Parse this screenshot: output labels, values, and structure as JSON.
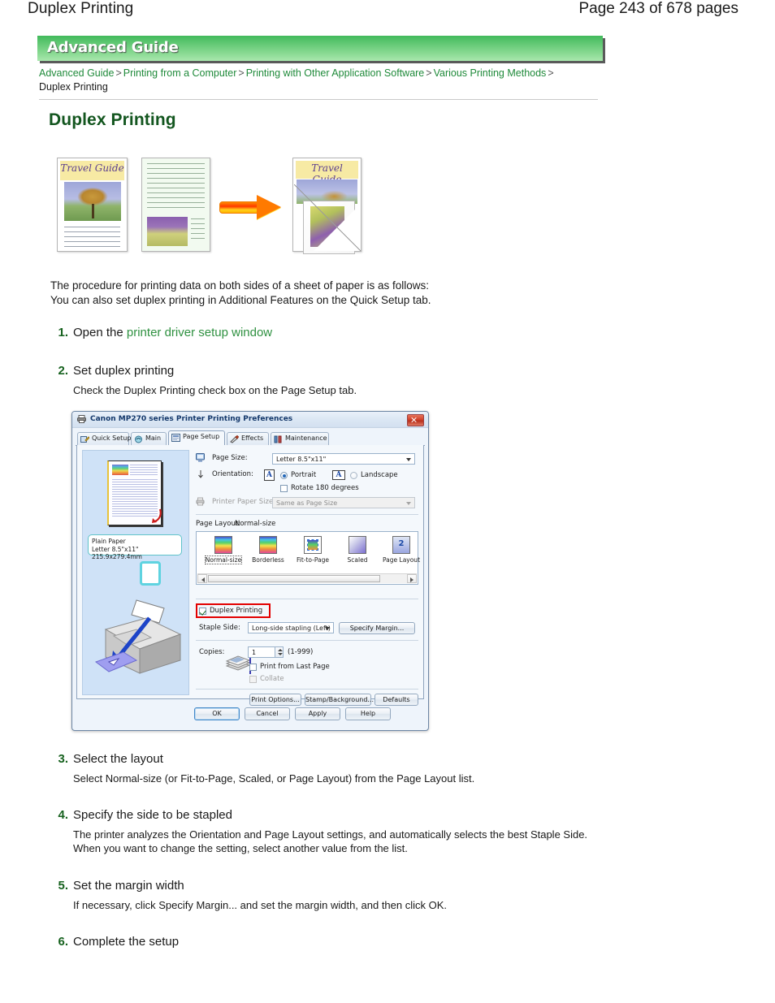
{
  "runhead": {
    "title": "Duplex Printing",
    "page_indicator": "Page 243 of 678 pages"
  },
  "guide": {
    "banner_label": "Advanced Guide",
    "breadcrumbs": [
      {
        "label": "Advanced Guide",
        "link": true
      },
      {
        "label": "Printing from a Computer",
        "link": true
      },
      {
        "label": "Printing with Other Application Software",
        "link": true
      },
      {
        "label": "Various Printing Methods",
        "link": true
      },
      {
        "label": "Duplex Printing",
        "link": false
      }
    ],
    "separator": ">"
  },
  "page": {
    "heading": "Duplex Printing",
    "intro_line1": "The procedure for printing data on both sides of a sheet of paper is as follows:",
    "intro_line2": "You can also set duplex printing in Additional Features on the Quick Setup tab."
  },
  "illustration": {
    "front_title": "Travel Guide",
    "result_title": "Travel Guide",
    "arrow": "right-arrow"
  },
  "steps": [
    {
      "num": "1.",
      "title_prefix": "Open the ",
      "title_link": "printer driver setup window",
      "body": ""
    },
    {
      "num": "2.",
      "title": "Set duplex printing",
      "body": "Check the Duplex Printing check box on the Page Setup tab."
    },
    {
      "num": "3.",
      "title": "Select the layout",
      "body": "Select Normal-size (or Fit-to-Page, Scaled, or Page Layout) from the Page Layout list."
    },
    {
      "num": "4.",
      "title": "Specify the side to be stapled",
      "body": "The printer analyzes the Orientation and Page Layout settings, and automatically selects the best Staple Side. When you want to change the setting, select another value from the list."
    },
    {
      "num": "5.",
      "title": "Set the margin width",
      "body": "If necessary, click Specify Margin... and set the margin width, and then click OK."
    },
    {
      "num": "6.",
      "title": "Complete the setup",
      "body": ""
    }
  ],
  "dialog": {
    "title": "Canon MP270 series Printer Printing Preferences",
    "close_label": "x",
    "tabs": [
      {
        "label": "Quick Setup",
        "icon": "quick-setup-icon",
        "selected": false
      },
      {
        "label": "Main",
        "icon": "main-icon",
        "selected": false
      },
      {
        "label": "Page Setup",
        "icon": "page-setup-icon",
        "selected": true
      },
      {
        "label": "Effects",
        "icon": "effects-icon",
        "selected": false
      },
      {
        "label": "Maintenance",
        "icon": "maintenance-icon",
        "selected": false
      }
    ],
    "preview": {
      "paper_type": "Plain Paper",
      "paper_size": "Letter 8.5\"x11\" 215.9x279.4mm"
    },
    "page_size": {
      "label": "Page Size:",
      "value": "Letter 8.5\"x11\""
    },
    "orientation": {
      "label": "Orientation:",
      "portrait": "Portrait",
      "landscape": "Landscape",
      "portrait_selected": true,
      "rotate_180": "Rotate 180 degrees",
      "rotate_180_checked": false
    },
    "printer_paper_size": {
      "label": "Printer Paper Size:",
      "value": "Same as Page Size",
      "disabled": true
    },
    "page_layout": {
      "label": "Page Layout:",
      "value": "Normal-size",
      "options": [
        {
          "label": "Normal-size",
          "icon": "normal-size-icon",
          "selected": true
        },
        {
          "label": "Borderless",
          "icon": "borderless-icon",
          "selected": false
        },
        {
          "label": "Fit-to-Page",
          "icon": "fit-to-page-icon",
          "selected": false
        },
        {
          "label": "Scaled",
          "icon": "scaled-icon",
          "selected": false
        },
        {
          "label": "Page Layout",
          "icon": "page-layout-icon",
          "selected": false
        }
      ]
    },
    "duplex": {
      "label": "Duplex Printing",
      "checked": true,
      "highlight_color": "#e30000"
    },
    "staple_side": {
      "label": "Staple Side:",
      "value": "Long-side stapling (Left)",
      "specify_margin_button": "Specify Margin..."
    },
    "copies": {
      "label": "Copies:",
      "value": "1",
      "range": "(1-999)",
      "print_from_last_page": "Print from Last Page",
      "print_from_last_page_checked": false,
      "collate": "Collate",
      "collate_checked": false,
      "collate_disabled": true
    },
    "option_buttons": [
      "Print Options...",
      "Stamp/Background...",
      "Defaults"
    ],
    "action_buttons": [
      {
        "label": "OK",
        "primary": true
      },
      {
        "label": "Cancel",
        "primary": false
      },
      {
        "label": "Apply",
        "primary": false
      },
      {
        "label": "Help",
        "primary": false
      }
    ]
  },
  "colors": {
    "banner_green_dark": "#41b95b",
    "banner_green_light": "#a9e7ae",
    "link_green": "#1f8a3a",
    "heading_green": "#13561f",
    "step_number_green": "#17621f",
    "highlight_red": "#e30000"
  }
}
